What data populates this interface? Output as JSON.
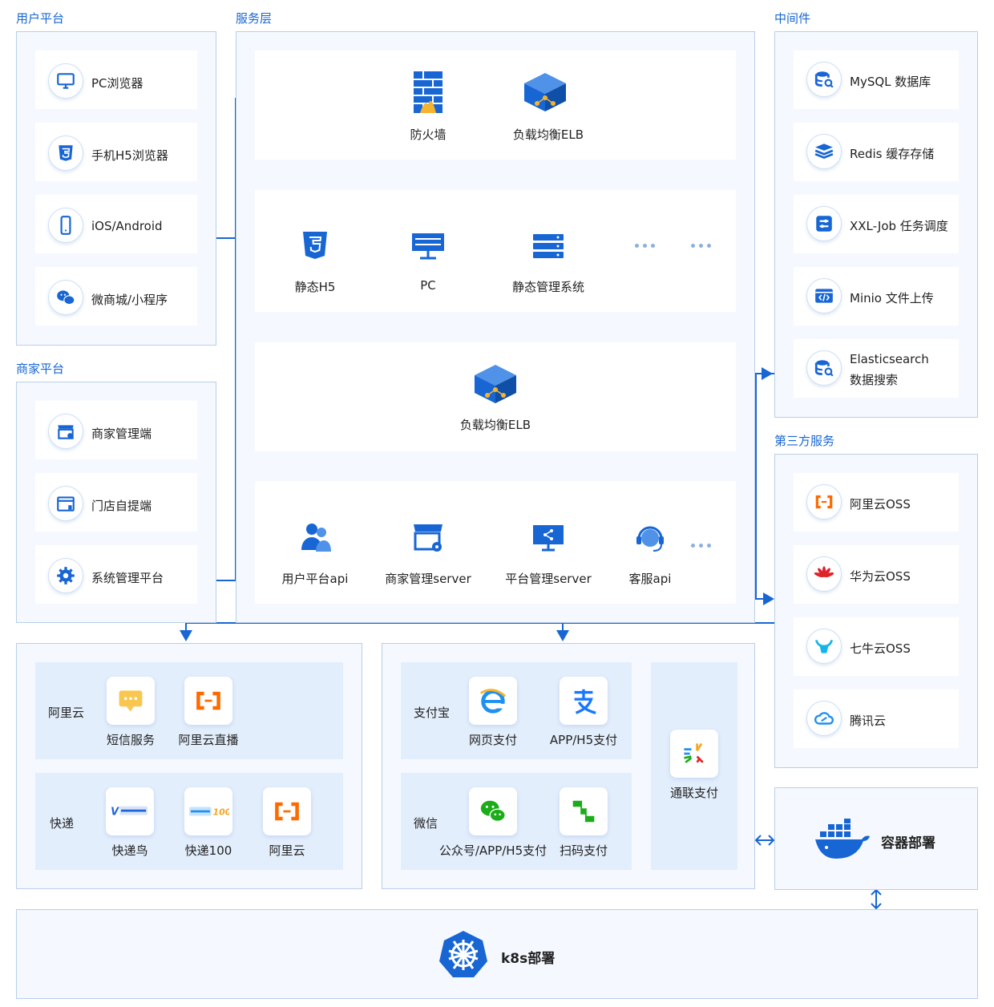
{
  "user_platform": {
    "title": "用户平台",
    "items": [
      "PC浏览器",
      "手机H5浏览器",
      "iOS/Android",
      "微商城/小程序"
    ]
  },
  "merchant_platform": {
    "title": "商家平台",
    "items": [
      "商家管理端",
      "门店自提端",
      "系统管理平台"
    ]
  },
  "service_layer": {
    "title": "服务层",
    "gateway": [
      "防火墙",
      "负载均衡ELB"
    ],
    "frontends": [
      "静态H5",
      "PC",
      "静态管理系统"
    ],
    "elb": "负载均衡ELB",
    "apis": [
      "用户平台api",
      "商家管理server",
      "平台管理server",
      "客服api"
    ]
  },
  "middleware": {
    "title": "中间件",
    "items": [
      "MySQL 数据库",
      "Redis 缓存存储",
      "XXL-Job 任务调度",
      "Minio 文件上传",
      "Elasticsearch",
      "数据搜索"
    ]
  },
  "third_party": {
    "title": "第三方服务",
    "items": [
      "阿里云OSS",
      "华为云OSS",
      "七牛云OSS",
      "腾讯云"
    ]
  },
  "services_left": {
    "aliyun": {
      "label": "阿里云",
      "items": [
        "短信服务",
        "阿里云直播"
      ]
    },
    "express": {
      "label": "快递",
      "items": [
        "快递鸟",
        "快递100",
        "阿里云"
      ]
    }
  },
  "payments": {
    "alipay": {
      "label": "支付宝",
      "items": [
        "网页支付",
        "APP/H5支付"
      ]
    },
    "wechat": {
      "label": "微信",
      "items": [
        "公众号/APP/H5支付",
        "扫码支付"
      ]
    },
    "unionpay": "通联支付"
  },
  "container": "容器部署",
  "k8s": "k8s部署",
  "colors": {
    "accent": "#1766d4",
    "panel": "#f5f9ff",
    "border": "#b9cfe8",
    "soft_blue": "#e3eefc"
  }
}
